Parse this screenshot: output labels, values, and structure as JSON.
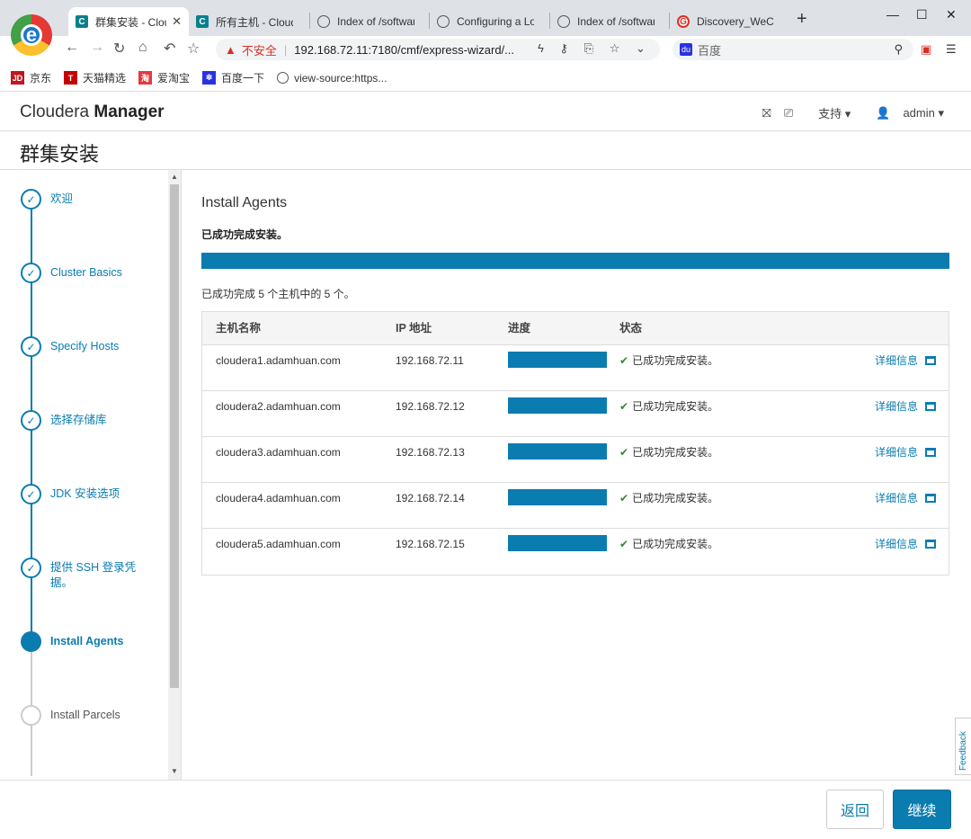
{
  "browser": {
    "tabs": [
      {
        "title": "群集安装 - Cloudera",
        "favicon": "cloudera"
      },
      {
        "title": "所有主机 - Cloudera",
        "favicon": "cloudera"
      },
      {
        "title": "Index of /software",
        "favicon": "globe"
      },
      {
        "title": "Configuring a Local",
        "favicon": "globe"
      },
      {
        "title": "Index of /software",
        "favicon": "globe"
      },
      {
        "title": "Discovery_WeChat",
        "favicon": "g"
      }
    ],
    "insecure_label": "不安全",
    "url": "192.168.72.11:7180/cmf/express-wizard/...",
    "search_placeholder": "百度",
    "bookmarks": [
      "京东",
      "天猫精选",
      "爱淘宝",
      "百度一下",
      "view-source:https..."
    ]
  },
  "app": {
    "brand_light": "Cloudera",
    "brand_bold": "Manager",
    "support_label": "支持",
    "user_label": "admin",
    "page_title": "群集安装"
  },
  "steps": [
    {
      "label": "欢迎",
      "state": "done"
    },
    {
      "label": "Cluster Basics",
      "state": "done"
    },
    {
      "label": "Specify Hosts",
      "state": "done"
    },
    {
      "label": "选择存储库",
      "state": "done"
    },
    {
      "label": "JDK 安装选项",
      "state": "done"
    },
    {
      "label": "提供 SSH 登录凭据。",
      "state": "done"
    },
    {
      "label": "Install Agents",
      "state": "current"
    },
    {
      "label": "Install Parcels",
      "state": "pending"
    }
  ],
  "main": {
    "title": "Install Agents",
    "success_msg": "已成功完成安装。",
    "progress": 1.0,
    "summary": "已成功完成 5 个主机中的 5 个。",
    "columns": [
      "主机名称",
      "IP 地址",
      "进度",
      "状态"
    ],
    "rows": [
      {
        "host": "cloudera1.adamhuan.com",
        "ip": "192.168.72.11",
        "progress": 1.0,
        "status": "已成功完成安装。",
        "details": "详细信息"
      },
      {
        "host": "cloudera2.adamhuan.com",
        "ip": "192.168.72.12",
        "progress": 1.0,
        "status": "已成功完成安装。",
        "details": "详细信息"
      },
      {
        "host": "cloudera3.adamhuan.com",
        "ip": "192.168.72.13",
        "progress": 1.0,
        "status": "已成功完成安装。",
        "details": "详细信息"
      },
      {
        "host": "cloudera4.adamhuan.com",
        "ip": "192.168.72.14",
        "progress": 1.0,
        "status": "已成功完成安装。",
        "details": "详细信息"
      },
      {
        "host": "cloudera5.adamhuan.com",
        "ip": "192.168.72.15",
        "progress": 1.0,
        "status": "已成功完成安装。",
        "details": "详细信息"
      }
    ]
  },
  "footer": {
    "back_label": "返回",
    "next_label": "继续"
  },
  "feedback_label": "Feedback",
  "colors": {
    "accent": "#0a7cb0",
    "success": "#2e8b2e"
  }
}
